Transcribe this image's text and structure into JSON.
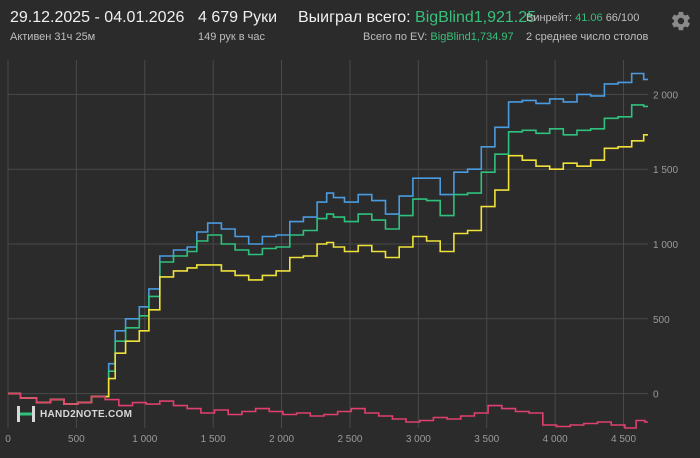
{
  "header": {
    "date_range": "29.12.2025 - 04.01.2026",
    "active_time": "Активен 31ч 25м",
    "hands": "4 679 Руки",
    "hands_per_hour": "149 рук в час",
    "won_label": "Выиграл всего:",
    "won_value": "BigBlind1,921.25",
    "ev_label": "Всего по EV:",
    "ev_value": "BigBlind1,734.97",
    "winrate_label": "Винрейт:",
    "winrate_value": "41.06",
    "winrate_suffix": "66/100",
    "avg_tables": "2 среднее число столов",
    "settings_icon": "gear-icon"
  },
  "logo": {
    "text": "HAND2NOTE.COM",
    "icon": "hand2note-logo-icon"
  },
  "colors": {
    "background": "#2b2b2b",
    "grid": "#4a4a4a",
    "blue": "#4a9be0",
    "green": "#2fc27e",
    "yellow": "#f0e13a",
    "pink": "#e0406e",
    "accent_text": "#37c07a"
  },
  "chart_data": {
    "type": "line",
    "x_ticks": [
      "0",
      "500",
      "1 000",
      "1 500",
      "2 000",
      "2 500",
      "3 000",
      "3 500",
      "4 000",
      "4 500"
    ],
    "x_tick_values": [
      0,
      500,
      1000,
      1500,
      2000,
      2500,
      3000,
      3500,
      4000,
      4500
    ],
    "y_ticks": [
      "0",
      "500",
      "1 000",
      "1 500",
      "2 000"
    ],
    "y_tick_values": [
      0,
      500,
      1000,
      1500,
      2000
    ],
    "xlim": [
      0,
      4679
    ],
    "ylim": [
      -230,
      2230
    ],
    "grid": true,
    "series": [
      {
        "color": "#4a9be0",
        "points": [
          [
            0,
            0
          ],
          [
            150,
            -30
          ],
          [
            250,
            -60
          ],
          [
            350,
            -40
          ],
          [
            450,
            -70
          ],
          [
            550,
            -60
          ],
          [
            650,
            -20
          ],
          [
            700,
            -20
          ],
          [
            760,
            200
          ],
          [
            800,
            420
          ],
          [
            900,
            500
          ],
          [
            1000,
            580
          ],
          [
            1050,
            700
          ],
          [
            1150,
            920
          ],
          [
            1250,
            960
          ],
          [
            1350,
            980
          ],
          [
            1400,
            1080
          ],
          [
            1500,
            1140
          ],
          [
            1600,
            1100
          ],
          [
            1700,
            1050
          ],
          [
            1800,
            1000
          ],
          [
            1900,
            1050
          ],
          [
            2000,
            1060
          ],
          [
            2100,
            1150
          ],
          [
            2200,
            1180
          ],
          [
            2300,
            1280
          ],
          [
            2350,
            1340
          ],
          [
            2400,
            1310
          ],
          [
            2500,
            1280
          ],
          [
            2600,
            1330
          ],
          [
            2700,
            1290
          ],
          [
            2800,
            1200
          ],
          [
            2900,
            1320
          ],
          [
            3000,
            1440
          ],
          [
            3100,
            1440
          ],
          [
            3200,
            1330
          ],
          [
            3300,
            1480
          ],
          [
            3400,
            1500
          ],
          [
            3500,
            1650
          ],
          [
            3600,
            1780
          ],
          [
            3700,
            1950
          ],
          [
            3800,
            1960
          ],
          [
            3900,
            1940
          ],
          [
            4000,
            1970
          ],
          [
            4100,
            1950
          ],
          [
            4200,
            2000
          ],
          [
            4300,
            1990
          ],
          [
            4400,
            2070
          ],
          [
            4500,
            2080
          ],
          [
            4600,
            2140
          ],
          [
            4679,
            2100
          ]
        ]
      },
      {
        "color": "#2fc27e",
        "points": [
          [
            0,
            0
          ],
          [
            150,
            -30
          ],
          [
            250,
            -60
          ],
          [
            350,
            -40
          ],
          [
            450,
            -70
          ],
          [
            550,
            -60
          ],
          [
            650,
            -20
          ],
          [
            700,
            -20
          ],
          [
            760,
            150
          ],
          [
            800,
            350
          ],
          [
            900,
            440
          ],
          [
            1000,
            520
          ],
          [
            1050,
            650
          ],
          [
            1150,
            880
          ],
          [
            1250,
            920
          ],
          [
            1350,
            950
          ],
          [
            1400,
            1020
          ],
          [
            1500,
            1060
          ],
          [
            1600,
            1000
          ],
          [
            1700,
            960
          ],
          [
            1800,
            930
          ],
          [
            1900,
            970
          ],
          [
            2000,
            980
          ],
          [
            2100,
            1060
          ],
          [
            2200,
            1090
          ],
          [
            2300,
            1170
          ],
          [
            2350,
            1200
          ],
          [
            2400,
            1180
          ],
          [
            2500,
            1150
          ],
          [
            2600,
            1200
          ],
          [
            2700,
            1160
          ],
          [
            2800,
            1100
          ],
          [
            2900,
            1190
          ],
          [
            3000,
            1300
          ],
          [
            3100,
            1290
          ],
          [
            3200,
            1190
          ],
          [
            3300,
            1330
          ],
          [
            3400,
            1340
          ],
          [
            3500,
            1480
          ],
          [
            3600,
            1600
          ],
          [
            3700,
            1750
          ],
          [
            3800,
            1760
          ],
          [
            3900,
            1740
          ],
          [
            4000,
            1770
          ],
          [
            4100,
            1730
          ],
          [
            4200,
            1760
          ],
          [
            4300,
            1770
          ],
          [
            4400,
            1840
          ],
          [
            4500,
            1850
          ],
          [
            4600,
            1930
          ],
          [
            4679,
            1920
          ]
        ]
      },
      {
        "color": "#f0e13a",
        "points": [
          [
            0,
            0
          ],
          [
            150,
            -30
          ],
          [
            250,
            -60
          ],
          [
            350,
            -40
          ],
          [
            450,
            -70
          ],
          [
            550,
            -60
          ],
          [
            650,
            -20
          ],
          [
            700,
            -20
          ],
          [
            760,
            100
          ],
          [
            800,
            270
          ],
          [
            900,
            350
          ],
          [
            1000,
            420
          ],
          [
            1050,
            560
          ],
          [
            1150,
            780
          ],
          [
            1250,
            820
          ],
          [
            1350,
            840
          ],
          [
            1400,
            860
          ],
          [
            1500,
            860
          ],
          [
            1600,
            820
          ],
          [
            1700,
            790
          ],
          [
            1800,
            760
          ],
          [
            1900,
            790
          ],
          [
            2000,
            820
          ],
          [
            2100,
            910
          ],
          [
            2200,
            920
          ],
          [
            2300,
            1000
          ],
          [
            2350,
            1010
          ],
          [
            2400,
            980
          ],
          [
            2500,
            950
          ],
          [
            2600,
            990
          ],
          [
            2700,
            950
          ],
          [
            2800,
            910
          ],
          [
            2900,
            980
          ],
          [
            3000,
            1050
          ],
          [
            3100,
            1020
          ],
          [
            3200,
            950
          ],
          [
            3300,
            1070
          ],
          [
            3400,
            1090
          ],
          [
            3500,
            1250
          ],
          [
            3600,
            1360
          ],
          [
            3700,
            1590
          ],
          [
            3800,
            1560
          ],
          [
            3900,
            1520
          ],
          [
            4000,
            1500
          ],
          [
            4100,
            1540
          ],
          [
            4200,
            1520
          ],
          [
            4300,
            1560
          ],
          [
            4400,
            1640
          ],
          [
            4500,
            1650
          ],
          [
            4600,
            1690
          ],
          [
            4679,
            1730
          ]
        ]
      },
      {
        "color": "#e0406e",
        "points": [
          [
            0,
            0
          ],
          [
            150,
            -30
          ],
          [
            250,
            -60
          ],
          [
            350,
            -40
          ],
          [
            450,
            -70
          ],
          [
            550,
            -60
          ],
          [
            650,
            -20
          ],
          [
            750,
            -40
          ],
          [
            850,
            -80
          ],
          [
            950,
            -60
          ],
          [
            1050,
            -70
          ],
          [
            1150,
            -50
          ],
          [
            1250,
            -80
          ],
          [
            1350,
            -100
          ],
          [
            1450,
            -130
          ],
          [
            1550,
            -110
          ],
          [
            1650,
            -140
          ],
          [
            1750,
            -120
          ],
          [
            1850,
            -100
          ],
          [
            1950,
            -120
          ],
          [
            2050,
            -140
          ],
          [
            2150,
            -130
          ],
          [
            2250,
            -150
          ],
          [
            2350,
            -140
          ],
          [
            2450,
            -120
          ],
          [
            2550,
            -100
          ],
          [
            2650,
            -130
          ],
          [
            2750,
            -150
          ],
          [
            2850,
            -170
          ],
          [
            2950,
            -190
          ],
          [
            3050,
            -180
          ],
          [
            3150,
            -160
          ],
          [
            3250,
            -170
          ],
          [
            3350,
            -150
          ],
          [
            3450,
            -130
          ],
          [
            3550,
            -80
          ],
          [
            3650,
            -100
          ],
          [
            3750,
            -120
          ],
          [
            3850,
            -130
          ],
          [
            3950,
            -210
          ],
          [
            4050,
            -220
          ],
          [
            4150,
            -210
          ],
          [
            4250,
            -200
          ],
          [
            4350,
            -190
          ],
          [
            4450,
            -210
          ],
          [
            4550,
            -230
          ],
          [
            4620,
            -180
          ],
          [
            4679,
            -190
          ]
        ]
      }
    ]
  }
}
